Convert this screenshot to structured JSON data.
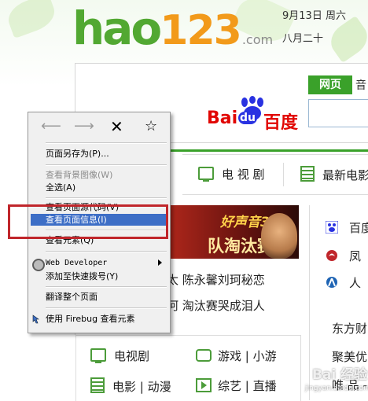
{
  "header": {
    "logo_main": "hao",
    "logo_num": "123",
    "logo_suffix": ".com",
    "date": "9月13日 周六",
    "lunar": "八月二十"
  },
  "search": {
    "tab_active": "网页",
    "tab_next": "音",
    "engine_logo": "Baidu百度"
  },
  "categories": {
    "tv": "电 视 剧",
    "film": "最新电影"
  },
  "banner": {
    "line1": "好声音3",
    "line2": "队淘汰赛"
  },
  "news": [
    "太 陈永馨刘珂秘恋",
    "河 淘汰赛哭成泪人"
  ],
  "right_links": [
    {
      "label": "百度",
      "icon": "baidu-paw-icon",
      "color": "#2932e1"
    },
    {
      "label": "凤",
      "icon": "phoenix-icon",
      "color": "#c0262b"
    },
    {
      "label": "人",
      "icon": "people-icon",
      "color": "#1e64b4"
    },
    {
      "label": "东方财",
      "icon": "",
      "color": ""
    },
    {
      "label": "聚美优",
      "icon": "",
      "color": ""
    },
    {
      "label": "唯 品 -",
      "icon": "",
      "color": ""
    }
  ],
  "bottom": {
    "tv": "电视剧",
    "game": "游戏 | 小游",
    "movie": "电影 | 动漫",
    "variety": "综艺 | 直播"
  },
  "context_menu": {
    "nav_icons": [
      "back-arrow-icon",
      "forward-arrow-icon",
      "stop-x-icon",
      "bookmark-star-icon"
    ],
    "items": [
      {
        "label": "页面另存为(P)...",
        "state": "normal"
      },
      {
        "label": "查看背景图像(W)",
        "state": "disabled"
      },
      {
        "label": "全选(A)",
        "state": "normal"
      },
      {
        "label": "查看页面源代码(V)",
        "state": "normal"
      },
      {
        "label": "查看页面信息(I)",
        "state": "selected"
      },
      {
        "label": "查看元素(Q)",
        "state": "normal"
      },
      {
        "label": "Web Developer",
        "state": "submenu"
      },
      {
        "label": "添加至快速拨号(Y)",
        "state": "normal"
      },
      {
        "label": "翻译整个页面",
        "state": "normal"
      },
      {
        "label": "使用 Firebug 查看元素",
        "state": "normal"
      }
    ]
  },
  "watermark": {
    "main": "Bai 经验",
    "sub": "jingyan.baidu.com"
  },
  "colors": {
    "accent_green": "#3aa12a",
    "highlight_red": "#c0262b",
    "menu_selected": "#3d6ec6"
  }
}
